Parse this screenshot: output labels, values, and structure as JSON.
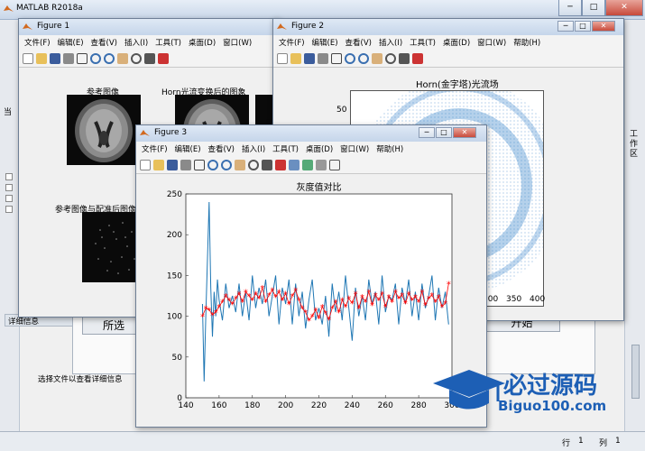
{
  "main": {
    "title": "MATLAB R2018a",
    "win_min": "─",
    "win_max": "□",
    "win_close": "✕",
    "right_tab": "工作区",
    "status_row": "行",
    "status_row_value": "1",
    "status_col": "列",
    "status_col_value": "1",
    "details_header": "详细信息",
    "select_hint": "选择文件以查看详细信息",
    "bg_button_left": "所选",
    "bg_button_right": "升始",
    "left_side_label": "当"
  },
  "figure1": {
    "title": "Figure 1",
    "menu": [
      "文件(F)",
      "编辑(E)",
      "查看(V)",
      "插入(I)",
      "工具(T)",
      "桌面(D)",
      "窗口(W)"
    ],
    "img1_title": "参考图像",
    "img2_title": "Horn光流变换后的图象",
    "img3_title": "参考图像与配准后图像"
  },
  "figure2": {
    "title": "Figure 2",
    "menu": [
      "文件(F)",
      "编辑(E)",
      "查看(V)",
      "插入(I)",
      "工具(T)",
      "桌面(D)",
      "窗口(W)",
      "帮助(H)"
    ],
    "plot_title": "Horn(金字塔)光流场",
    "ytick": "50",
    "xticks": [
      "300",
      "350",
      "400"
    ]
  },
  "figure3": {
    "title": "Figure 3",
    "menu": [
      "文件(F)",
      "编辑(E)",
      "查看(V)",
      "插入(I)",
      "工具(T)",
      "桌面(D)",
      "窗口(W)",
      "帮助(H)"
    ]
  },
  "watermark": {
    "cn": "必过源码",
    "url": "Biguo100.com"
  },
  "chart_data": {
    "type": "line",
    "title": "灰度值对比",
    "xlabel": "",
    "ylabel": "",
    "xlim": [
      140,
      300
    ],
    "ylim": [
      0,
      250
    ],
    "xticks": [
      140,
      160,
      180,
      200,
      220,
      240,
      260,
      280,
      300
    ],
    "yticks": [
      0,
      50,
      100,
      150,
      200,
      250
    ],
    "colors": {
      "series1": "#1f77b4",
      "series2": "#ff0000"
    },
    "series": [
      {
        "name": "",
        "style": "line",
        "x": [
          150,
          151,
          152,
          153,
          154,
          155,
          156,
          157,
          158,
          159,
          160,
          162,
          164,
          166,
          168,
          170,
          172,
          174,
          176,
          178,
          180,
          182,
          184,
          186,
          188,
          190,
          192,
          194,
          196,
          198,
          200,
          202,
          204,
          206,
          208,
          210,
          212,
          214,
          216,
          218,
          220,
          222,
          224,
          226,
          228,
          230,
          232,
          234,
          236,
          238,
          240,
          242,
          244,
          246,
          248,
          250,
          252,
          254,
          256,
          258,
          260,
          262,
          264,
          266,
          268,
          270,
          272,
          274,
          276,
          278,
          280,
          282,
          284,
          286,
          288,
          290,
          292,
          294,
          296,
          298
        ],
        "y": [
          115,
          20,
          100,
          170,
          240,
          135,
          75,
          130,
          100,
          145,
          120,
          95,
          140,
          110,
          125,
          105,
          140,
          100,
          130,
          95,
          150,
          110,
          135,
          115,
          145,
          100,
          125,
          150,
          90,
          135,
          115,
          145,
          90,
          140,
          100,
          130,
          85,
          120,
          145,
          95,
          110,
          90,
          125,
          75,
          140,
          105,
          130,
          95,
          150,
          110,
          70,
          135,
          100,
          125,
          95,
          145,
          115,
          130,
          90,
          150,
          105,
          125,
          120,
          140,
          90,
          135,
          115,
          145,
          100,
          130,
          95,
          140,
          110,
          125,
          150,
          95,
          135,
          110,
          130,
          90
        ]
      },
      {
        "name": "",
        "style": "markers",
        "marker": "*",
        "x": [
          150,
          152,
          154,
          156,
          158,
          160,
          162,
          164,
          166,
          168,
          170,
          172,
          174,
          176,
          178,
          180,
          182,
          184,
          186,
          188,
          190,
          192,
          194,
          196,
          198,
          200,
          202,
          204,
          206,
          208,
          210,
          212,
          214,
          216,
          218,
          220,
          222,
          224,
          226,
          228,
          230,
          232,
          234,
          236,
          238,
          240,
          242,
          244,
          246,
          248,
          250,
          252,
          254,
          256,
          258,
          260,
          262,
          264,
          266,
          268,
          270,
          272,
          274,
          276,
          278,
          280,
          282,
          284,
          286,
          288,
          290,
          292,
          294,
          296,
          298
        ],
        "y": [
          100,
          110,
          108,
          102,
          105,
          112,
          118,
          125,
          120,
          115,
          122,
          128,
          118,
          130,
          125,
          120,
          128,
          122,
          135,
          118,
          126,
          132,
          124,
          130,
          120,
          128,
          115,
          125,
          132,
          120,
          110,
          105,
          95,
          100,
          108,
          98,
          112,
          104,
          96,
          110,
          118,
          105,
          120,
          112,
          122,
          116,
          128,
          110,
          124,
          118,
          130,
          114,
          126,
          120,
          128,
          112,
          124,
          118,
          130,
          122,
          126,
          116,
          128,
          120,
          124,
          118,
          130,
          114,
          122,
          126,
          118,
          124,
          112,
          116,
          140
        ]
      }
    ]
  }
}
